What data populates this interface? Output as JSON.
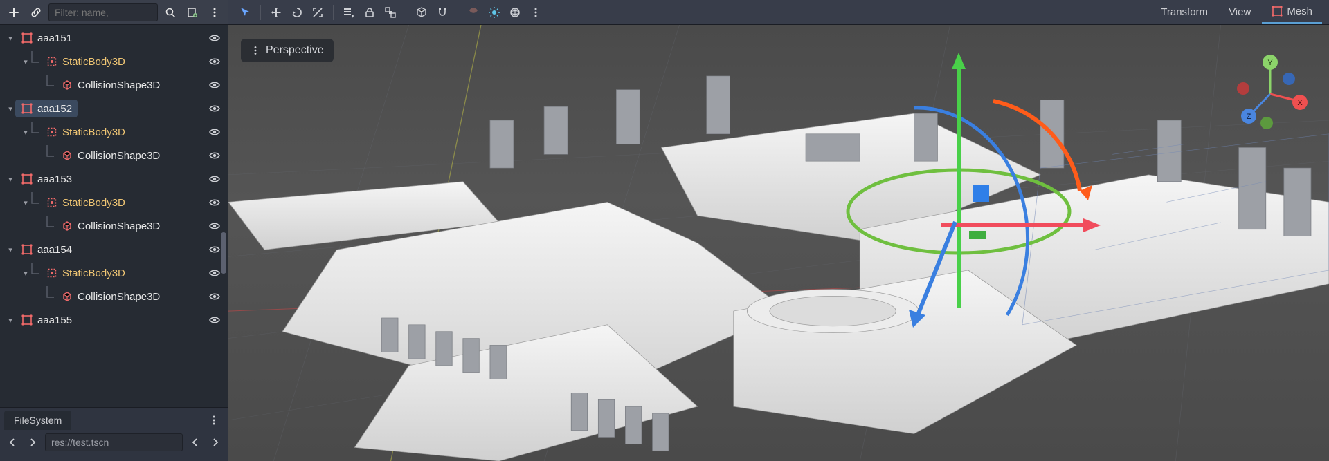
{
  "leftHeader": {
    "filterPlaceholder": "Filter: name,"
  },
  "viewportToolbar": {
    "tabs": {
      "transform": "Transform",
      "view": "View",
      "mesh": "Mesh"
    }
  },
  "perspective": {
    "label": "Perspective"
  },
  "axisGizmo": {
    "x": "X",
    "y": "Y",
    "z": "Z"
  },
  "sceneTree": [
    {
      "depth": 0,
      "expand": "v",
      "iconType": "mesh",
      "label": "aaa151",
      "labelColor": "white",
      "selected": false
    },
    {
      "depth": 1,
      "expand": "v",
      "iconType": "body",
      "label": "StaticBody3D",
      "labelColor": "yellow",
      "selected": false
    },
    {
      "depth": 2,
      "expand": "",
      "iconType": "collision",
      "label": "CollisionShape3D",
      "labelColor": "white",
      "selected": false
    },
    {
      "depth": 0,
      "expand": "v",
      "iconType": "mesh",
      "label": "aaa152",
      "labelColor": "white",
      "selected": true
    },
    {
      "depth": 1,
      "expand": "v",
      "iconType": "body",
      "label": "StaticBody3D",
      "labelColor": "yellow",
      "selected": false
    },
    {
      "depth": 2,
      "expand": "",
      "iconType": "collision",
      "label": "CollisionShape3D",
      "labelColor": "white",
      "selected": false
    },
    {
      "depth": 0,
      "expand": "v",
      "iconType": "mesh",
      "label": "aaa153",
      "labelColor": "white",
      "selected": false
    },
    {
      "depth": 1,
      "expand": "v",
      "iconType": "body",
      "label": "StaticBody3D",
      "labelColor": "yellow",
      "selected": false
    },
    {
      "depth": 2,
      "expand": "",
      "iconType": "collision",
      "label": "CollisionShape3D",
      "labelColor": "white",
      "selected": false
    },
    {
      "depth": 0,
      "expand": "v",
      "iconType": "mesh",
      "label": "aaa154",
      "labelColor": "white",
      "selected": false
    },
    {
      "depth": 1,
      "expand": "v",
      "iconType": "body",
      "label": "StaticBody3D",
      "labelColor": "yellow",
      "selected": false
    },
    {
      "depth": 2,
      "expand": "",
      "iconType": "collision",
      "label": "CollisionShape3D",
      "labelColor": "white",
      "selected": false
    },
    {
      "depth": 0,
      "expand": "v",
      "iconType": "mesh",
      "label": "aaa155",
      "labelColor": "white",
      "selected": false
    }
  ],
  "fileSystem": {
    "tabLabel": "FileSystem",
    "path": "res://test.tscn"
  }
}
